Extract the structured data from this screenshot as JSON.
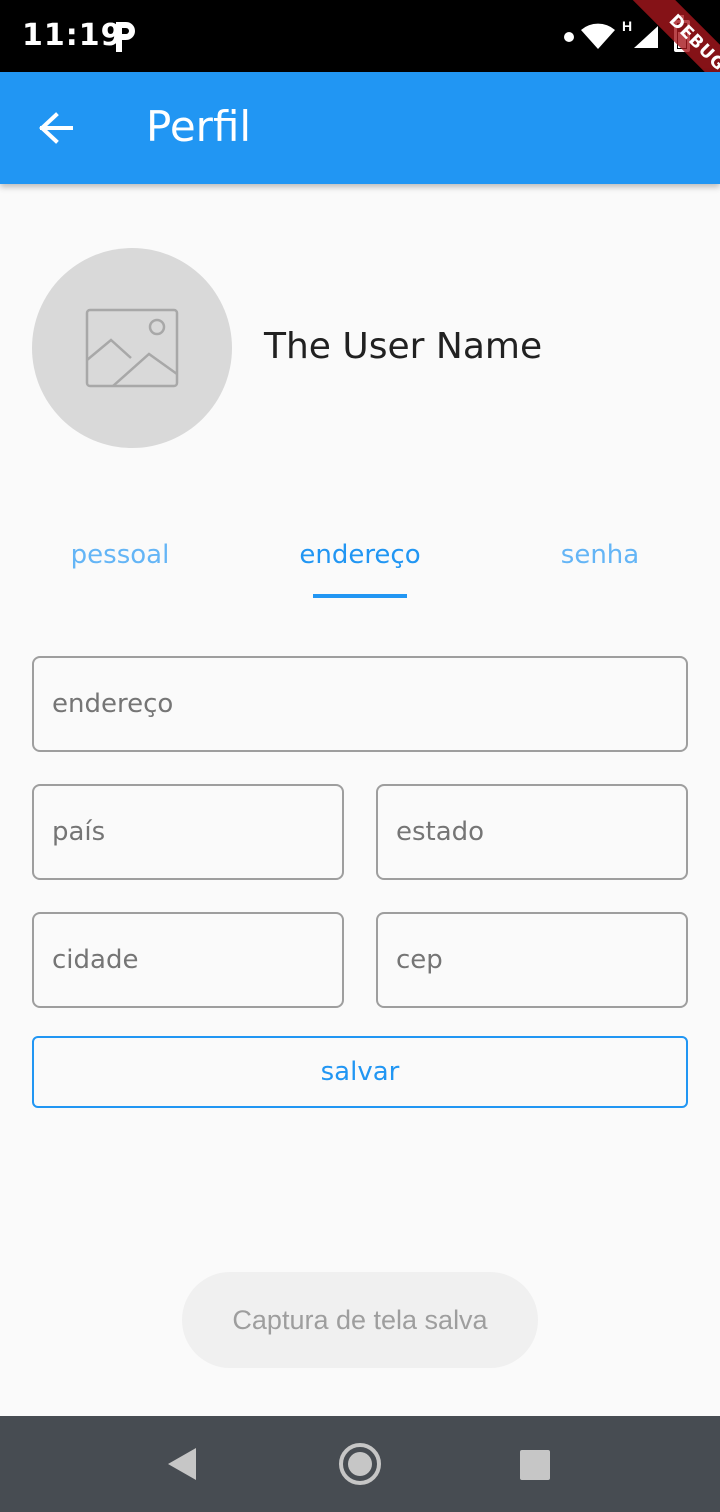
{
  "status_bar": {
    "time": "11:19",
    "network_label": "H"
  },
  "debug_banner": "DEBUG",
  "app_bar": {
    "title": "Perfil",
    "back_icon": "arrow-back-icon",
    "color": "#2196f3"
  },
  "profile": {
    "avatar_icon": "image-placeholder-icon",
    "user_name": "The User Name"
  },
  "tabs": [
    {
      "label": "pessoal",
      "active": false
    },
    {
      "label": "endereço",
      "active": true
    },
    {
      "label": "senha",
      "active": false
    }
  ],
  "form": {
    "endereco_placeholder": "endereço",
    "pais_placeholder": "país",
    "estado_placeholder": "estado",
    "cidade_placeholder": "cidade",
    "cep_placeholder": "cep",
    "save_label": "salvar"
  },
  "toast": "Captura de tela salva",
  "nav_bar": {
    "back_icon": "nav-back-icon",
    "home_icon": "nav-home-icon",
    "recents_icon": "nav-recents-icon"
  }
}
